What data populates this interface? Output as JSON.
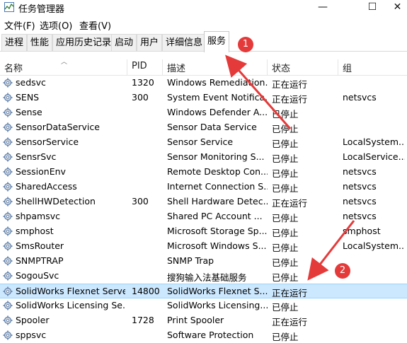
{
  "window": {
    "title": "任务管理器",
    "minimize": "—",
    "maximize": "☐",
    "close": "✕"
  },
  "menu": [
    "文件(F)",
    "选项(O)",
    "查看(V)"
  ],
  "tabs": [
    "进程",
    "性能",
    "应用历史记录",
    "启动",
    "用户",
    "详细信息",
    "服务"
  ],
  "active_tab": "服务",
  "columns": {
    "name": "名称",
    "pid": "PID",
    "desc": "描述",
    "status": "状态",
    "group": "组"
  },
  "rows": [
    {
      "name": "sedsvc",
      "pid": "1320",
      "desc": "Windows Remediation...",
      "status": "正在运行",
      "group": ""
    },
    {
      "name": "SENS",
      "pid": "300",
      "desc": "System Event Notifica...",
      "status": "正在运行",
      "group": "netsvcs"
    },
    {
      "name": "Sense",
      "pid": "",
      "desc": "Windows Defender A...",
      "status": "已停止",
      "group": ""
    },
    {
      "name": "SensorDataService",
      "pid": "",
      "desc": "Sensor Data Service",
      "status": "已停止",
      "group": ""
    },
    {
      "name": "SensorService",
      "pid": "",
      "desc": "Sensor Service",
      "status": "已停止",
      "group": "LocalSystem..."
    },
    {
      "name": "SensrSvc",
      "pid": "",
      "desc": "Sensor Monitoring S...",
      "status": "已停止",
      "group": "LocalService..."
    },
    {
      "name": "SessionEnv",
      "pid": "",
      "desc": "Remote Desktop Con...",
      "status": "已停止",
      "group": "netsvcs"
    },
    {
      "name": "SharedAccess",
      "pid": "",
      "desc": "Internet Connection S...",
      "status": "已停止",
      "group": "netsvcs"
    },
    {
      "name": "ShellHWDetection",
      "pid": "300",
      "desc": "Shell Hardware Detec...",
      "status": "正在运行",
      "group": "netsvcs"
    },
    {
      "name": "shpamsvc",
      "pid": "",
      "desc": "Shared PC Account ...",
      "status": "已停止",
      "group": "netsvcs"
    },
    {
      "name": "smphost",
      "pid": "",
      "desc": "Microsoft Storage Sp...",
      "status": "已停止",
      "group": "smphost"
    },
    {
      "name": "SmsRouter",
      "pid": "",
      "desc": "Microsoft Windows S...",
      "status": "已停止",
      "group": "LocalSystem..."
    },
    {
      "name": "SNMPTRAP",
      "pid": "",
      "desc": "SNMP Trap",
      "status": "已停止",
      "group": ""
    },
    {
      "name": "SogouSvc",
      "pid": "",
      "desc": "搜狗输入法基础服务",
      "status": "已停止",
      "group": ""
    },
    {
      "name": "SolidWorks Flexnet Server",
      "pid": "14800",
      "desc": "SolidWorks Flexnet S...",
      "status": "正在运行",
      "group": "",
      "selected": true
    },
    {
      "name": "SolidWorks Licensing Se...",
      "pid": "",
      "desc": "SolidWorks Licensing...",
      "status": "已停止",
      "group": ""
    },
    {
      "name": "Spooler",
      "pid": "1728",
      "desc": "Print Spooler",
      "status": "正在运行",
      "group": ""
    },
    {
      "name": "sppsvc",
      "pid": "",
      "desc": "Software Protection",
      "status": "已停止",
      "group": ""
    }
  ],
  "annotations": {
    "badge1": "1",
    "badge2": "2",
    "color": "#e53a3a"
  }
}
